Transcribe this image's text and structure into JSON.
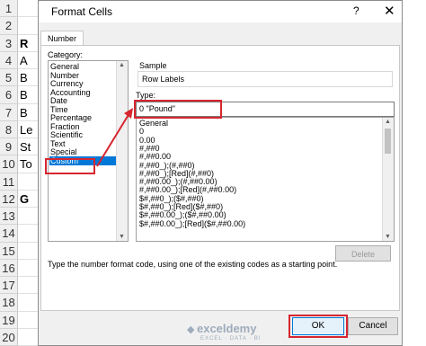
{
  "sheet": {
    "row_numbers": [
      "1",
      "2",
      "3",
      "4",
      "5",
      "6",
      "7",
      "8",
      "9",
      "10",
      "11",
      "12",
      "13",
      "14",
      "15",
      "16",
      "17",
      "18",
      "19",
      "20"
    ],
    "col_a_visible": [
      "",
      "",
      "R",
      "A",
      "B",
      "B",
      "B",
      "Le",
      "St",
      "To",
      "",
      "G",
      "",
      "",
      "",
      "",
      "",
      "",
      "",
      ""
    ]
  },
  "dialog": {
    "title": "Format Cells",
    "help": "?",
    "close": "✕",
    "tab": "Number",
    "category_label": "Category:",
    "categories": [
      "General",
      "Number",
      "Currency",
      "Accounting",
      "Date",
      "Time",
      "Percentage",
      "Fraction",
      "Scientific",
      "Text",
      "Special",
      "Custom"
    ],
    "selected_category": "Custom",
    "sample_label": "Sample",
    "sample_value": "Row Labels",
    "type_label": "Type:",
    "type_value": "0 \"Pound\"",
    "formats": [
      "General",
      "0",
      "0.00",
      "#,##0",
      "#,##0.00",
      "#,##0_);(#,##0)",
      "#,##0_);[Red](#,##0)",
      "#,##0.00_);(#,##0.00)",
      "#,##0.00_);[Red](#,##0.00)",
      "$#,##0_);($#,##0)",
      "$#,##0_);[Red]($#,##0)",
      "$#,##0.00_);($#,##0.00)",
      "$#,##0.00_);[Red]($#,##0.00)"
    ],
    "delete_label": "Delete",
    "description": "Type the number format code, using one of the existing codes as a starting point.",
    "ok_label": "OK",
    "cancel_label": "Cancel"
  },
  "watermark": {
    "name": "exceldemy",
    "tagline": "EXCEL · DATA · BI"
  },
  "colors": {
    "highlight": "#0078d7",
    "annotation": "#d6262f"
  }
}
